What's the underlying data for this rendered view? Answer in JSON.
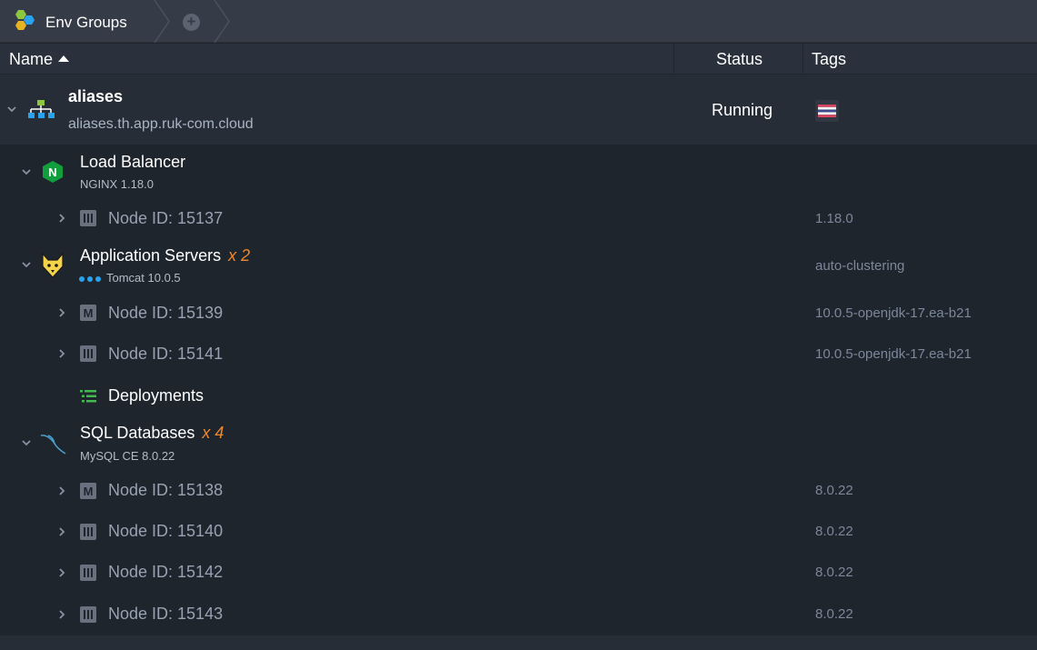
{
  "breadcrumb": {
    "title": "Env Groups",
    "add_icon": "plus-circle-icon"
  },
  "columns": {
    "name": "Name",
    "status": "Status",
    "tags": "Tags"
  },
  "environment": {
    "name": "aliases",
    "domain": "aliases.th.app.ruk-com.cloud",
    "status": "Running"
  },
  "groups": {
    "lb": {
      "name": "Load Balancer",
      "version": "NGINX 1.18.0"
    },
    "app": {
      "name": "Application Servers",
      "count": "x 2",
      "version": "Tomcat 10.0.5",
      "tag": "auto-clustering"
    },
    "db": {
      "name": "SQL Databases",
      "count": "x 4",
      "version": "MySQL CE 8.0.22"
    }
  },
  "deployments": "Deployments",
  "nodes": [
    {
      "label": "Node ID: 15137",
      "tag": "1.18.0",
      "type": "standard"
    },
    {
      "label": "Node ID: 15139",
      "tag": "10.0.5-openjdk-17.ea-b21",
      "type": "master"
    },
    {
      "label": "Node ID: 15141",
      "tag": "10.0.5-openjdk-17.ea-b21",
      "type": "standard"
    },
    {
      "label": "Node ID: 15138",
      "tag": "8.0.22",
      "type": "master"
    },
    {
      "label": "Node ID: 15140",
      "tag": "8.0.22",
      "type": "standard"
    },
    {
      "label": "Node ID: 15142",
      "tag": "8.0.22",
      "type": "standard"
    },
    {
      "label": "Node ID: 15143",
      "tag": "8.0.22",
      "type": "standard"
    }
  ],
  "colors": {
    "accent_orange": "#f0882c",
    "nginx_green": "#119e3c",
    "env_blue": "#2aa3ef"
  }
}
